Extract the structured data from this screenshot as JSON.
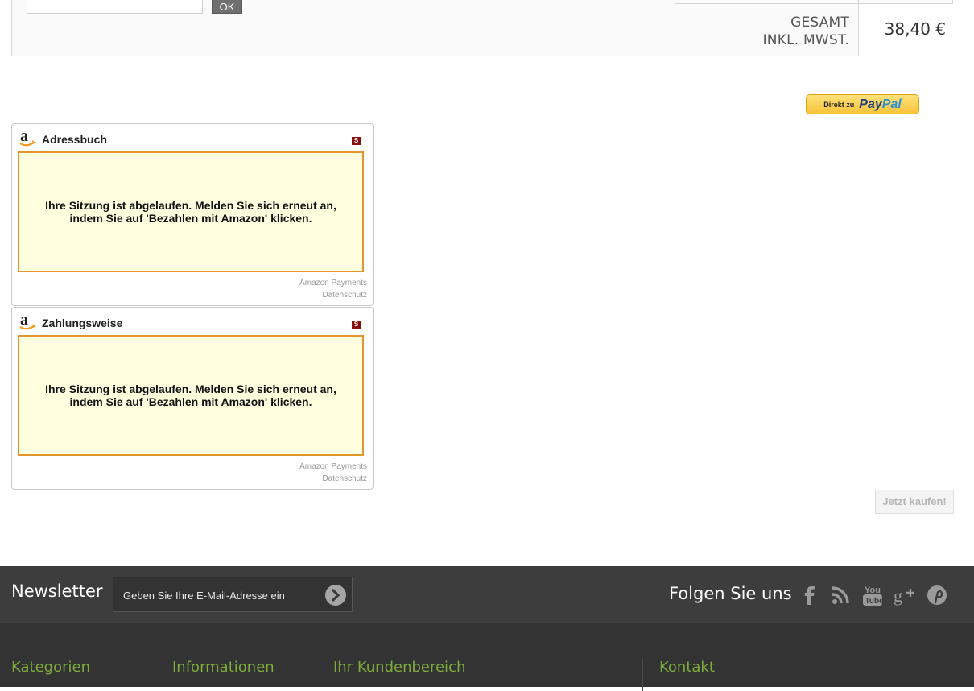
{
  "cart": {
    "voucher_value": "",
    "ok_label": "OK",
    "total_label_line1": "GESAMT",
    "total_label_line2": "INKL. MWST.",
    "total_value": "38,40 €"
  },
  "paypal": {
    "prefix": "Direkt zu",
    "brand_pay": "Pay",
    "brand_pal": "Pal"
  },
  "amazon_widgets": [
    {
      "title": "Adressbuch",
      "badge": "S",
      "message": "Ihre Sitzung ist abgelaufen. Melden Sie sich erneut an, indem Sie auf 'Bezahlen mit Amazon' klicken.",
      "footer_line1": "Amazon Payments",
      "footer_line2": "Datenschutz"
    },
    {
      "title": "Zahlungsweise",
      "badge": "S",
      "message": "Ihre Sitzung ist abgelaufen. Melden Sie sich erneut an, indem Sie auf 'Bezahlen mit Amazon' klicken.",
      "footer_line1": "Amazon Payments",
      "footer_line2": "Datenschutz"
    }
  ],
  "buy_button": "Jetzt kaufen!",
  "footer": {
    "newsletter_title": "Newsletter",
    "newsletter_placeholder": "Geben Sie Ihre E-Mail-Adresse ein",
    "follow_title": "Folgen Sie uns",
    "social_icons": [
      "facebook-icon",
      "rss-icon",
      "youtube-icon",
      "google-plus-icon",
      "pinterest-icon"
    ],
    "columns": [
      "Kategorien",
      "Informationen",
      "Ihr Kundenbereich",
      "Kontakt"
    ]
  },
  "colors": {
    "accent_green": "#7dab3c",
    "amazon_border": "#e0952d",
    "amazon_bg": "#ffffdf",
    "footer_dark": "#333333"
  }
}
